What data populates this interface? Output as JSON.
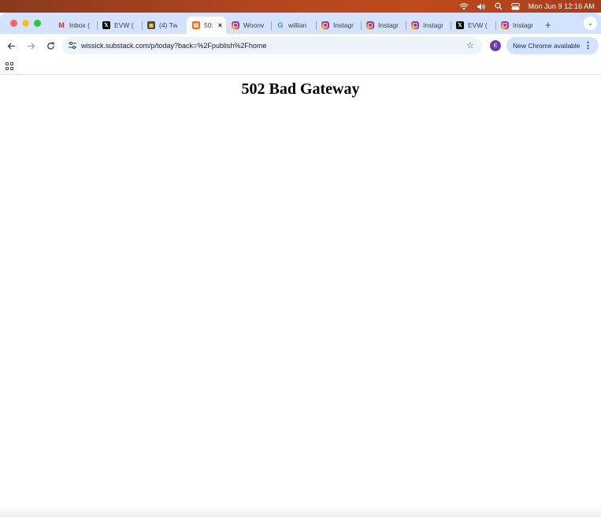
{
  "menubar": {
    "icons": [
      "wifi-icon",
      "volume-icon",
      "search-icon",
      "control-center-icon"
    ],
    "clock": "Mon Jun 9  12:16 AM"
  },
  "tabs": [
    {
      "title": "Inbox (",
      "favicon": "gmail-icon",
      "active": false
    },
    {
      "title": "EVW (",
      "favicon": "x-icon",
      "active": false
    },
    {
      "title": "(4) Tw",
      "favicon": "twitter-avatar-icon",
      "active": false
    },
    {
      "title": "50:",
      "favicon": "substack-icon",
      "active": true,
      "close": "×"
    },
    {
      "title": "Woonv",
      "favicon": "instagram-icon",
      "active": false
    },
    {
      "title": "willian",
      "favicon": "google-icon",
      "active": false
    },
    {
      "title": "Instagr",
      "favicon": "instagram-icon",
      "active": false
    },
    {
      "title": "Instagr",
      "favicon": "instagram-icon",
      "active": false
    },
    {
      "title": "Instagr",
      "favicon": "instagram-icon",
      "active": false
    },
    {
      "title": "EVW (",
      "favicon": "x-icon",
      "active": false
    },
    {
      "title": "Instagr",
      "favicon": "instagram-icon",
      "active": false
    }
  ],
  "new_tab": "+",
  "toolbar": {
    "url": "wissick.substack.com/p/today?back=%2Fpublish%2Fhome",
    "profile_initial": "E",
    "update_label": "New Chrome available"
  },
  "page": {
    "heading": "502 Bad Gateway"
  },
  "colors": {
    "tabstrip": "#d3e3fd",
    "omnibox": "#eef2f9",
    "avatar": "#6a3fa0"
  }
}
